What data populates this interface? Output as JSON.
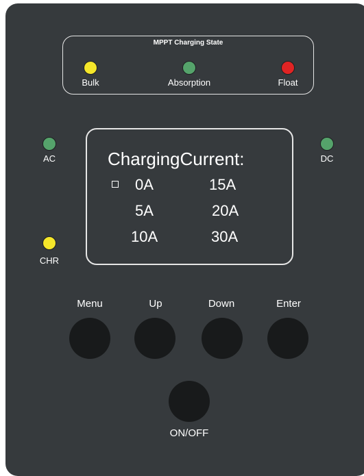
{
  "charging_state": {
    "title": "MPPT Charging State",
    "leds": [
      {
        "label": "Bulk",
        "color": "#f5e62a"
      },
      {
        "label": "Absorption",
        "color": "#55a36b"
      },
      {
        "label": "Float",
        "color": "#e02424"
      }
    ]
  },
  "indicators": {
    "ac": {
      "label": "AC",
      "color": "#55a36b"
    },
    "dc": {
      "label": "DC",
      "color": "#55a36b"
    },
    "chr": {
      "label": "CHR",
      "color": "#f5e62a"
    }
  },
  "display": {
    "title": "ChargingCurrent:",
    "selected_index": 0,
    "options": [
      "0A",
      "15A",
      "5A",
      "20A",
      "10A",
      "30A"
    ]
  },
  "buttons": {
    "menu": "Menu",
    "up": "Up",
    "down": "Down",
    "enter": "Enter",
    "power": "ON/OFF"
  }
}
